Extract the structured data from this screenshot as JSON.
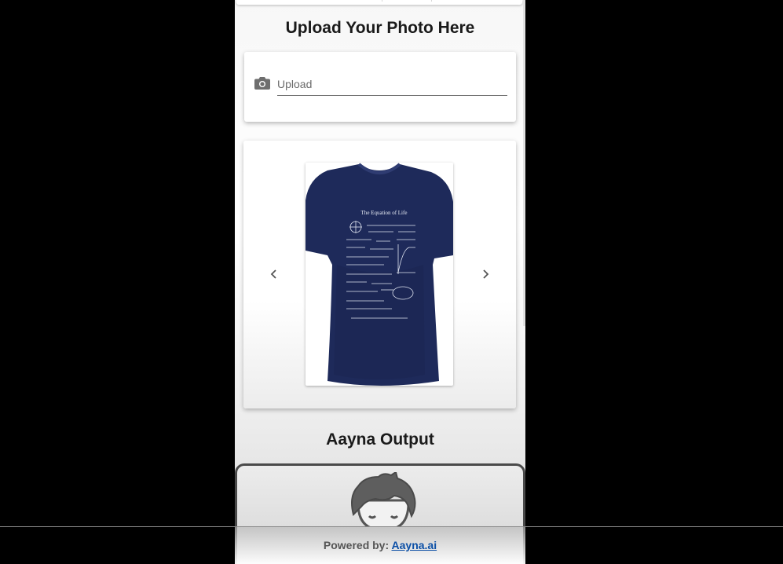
{
  "upload_section": {
    "title": "Upload Your Photo Here",
    "field_placeholder": "Upload",
    "icon": "camera-icon"
  },
  "carousel": {
    "prev_icon": "chevron-left-icon",
    "next_icon": "chevron-right-icon",
    "product": {
      "shirt_color": "#1e2a5a",
      "print_title": "The Equation of Life"
    }
  },
  "output_section": {
    "title": "Aayna Output",
    "placeholder_icon": "avatar-icon"
  },
  "footer": {
    "prefix": "Powered by:",
    "link_text": "Aayna.ai",
    "link_color": "#0b4fa6"
  }
}
